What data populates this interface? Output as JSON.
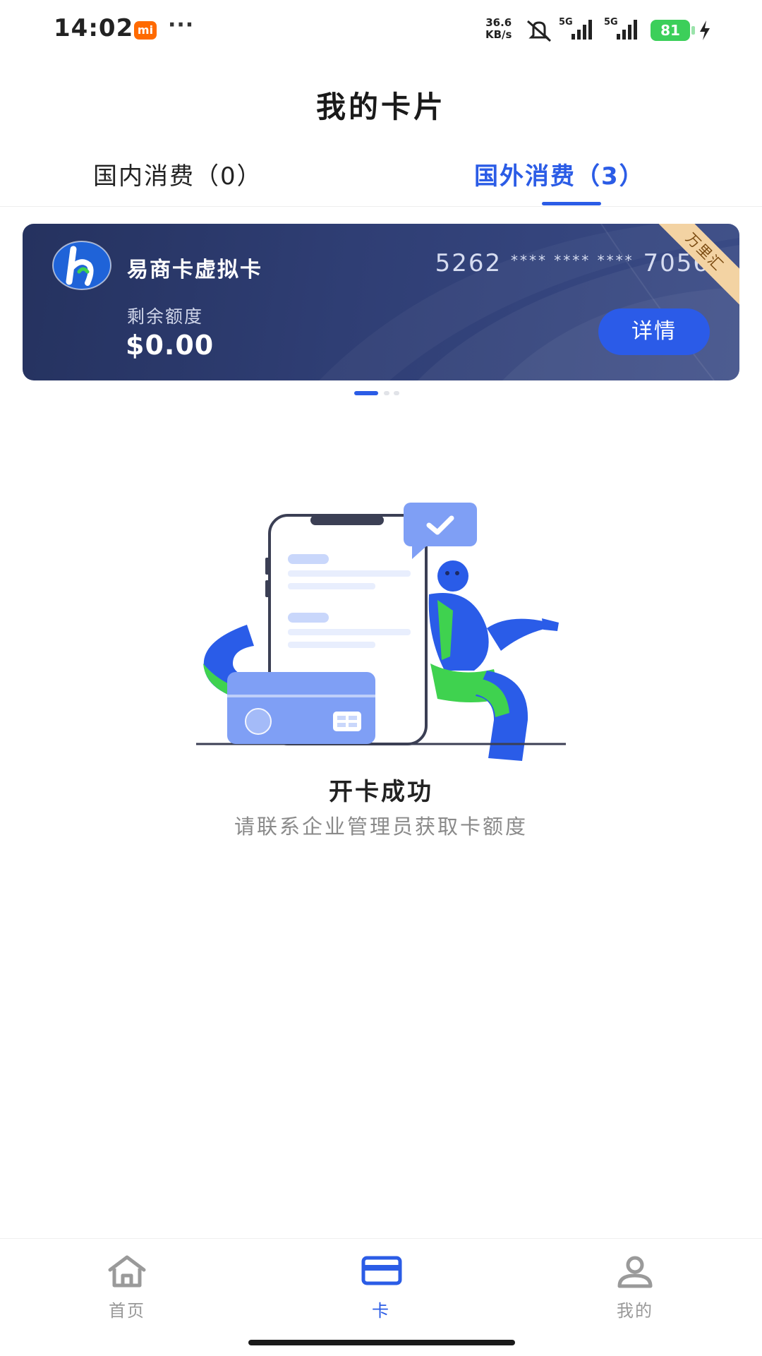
{
  "status_bar": {
    "time": "14:02",
    "mi_badge": "mi",
    "more": "···",
    "net_speed_value": "36.6",
    "net_speed_unit": "KB/s",
    "signal_1": "5G",
    "signal_2": "5G",
    "battery": "81",
    "icons": [
      "xiaomi-icon",
      "mute-icon",
      "signal-icon",
      "battery-icon",
      "charging-icon"
    ]
  },
  "header": {
    "title": "我的卡片"
  },
  "tabs": [
    {
      "label": "国内消费（0）",
      "active": false
    },
    {
      "label": "国外消费（3）",
      "active": true
    }
  ],
  "card": {
    "name": "易商卡虚拟卡",
    "number_prefix": "5262",
    "mask": "**** **** ****",
    "number_suffix": "7056",
    "balance_label": "剩余额度",
    "balance": "$0.00",
    "detail_button": "详情",
    "ribbon": "万里汇",
    "logo_icon": "brand-logo-icon"
  },
  "pager": {
    "count": 3,
    "active_index": 0
  },
  "empty_state": {
    "title": "开卡成功",
    "subtitle": "请联系企业管理员获取卡额度",
    "illustration": "card-opened-illustration"
  },
  "bottom_nav": [
    {
      "label": "首页",
      "icon": "home-icon",
      "active": false
    },
    {
      "label": "卡",
      "icon": "card-icon",
      "active": true
    },
    {
      "label": "我的",
      "icon": "profile-icon",
      "active": false
    }
  ],
  "colors": {
    "accent": "#2b5ce6",
    "card_bg": "#2f3e74",
    "ribbon": "#f3d3a3",
    "illustration_blue": "#2a5ce8",
    "illustration_green": "#3fd24f",
    "illustration_light": "#7f9ff5"
  }
}
